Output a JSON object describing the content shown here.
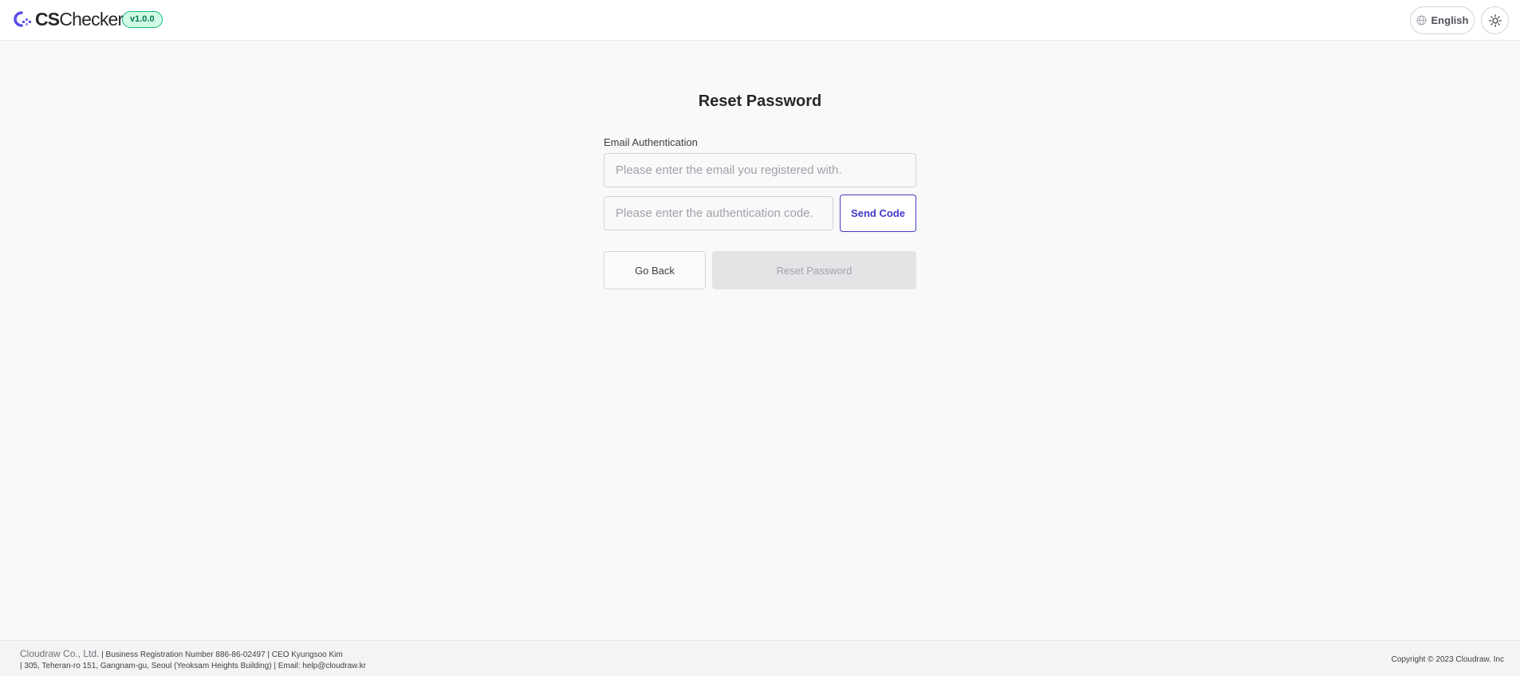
{
  "header": {
    "logo_bold": "CS",
    "logo_light": "Checker",
    "version": "v1.0.0",
    "language": "English",
    "logo_color": "#5b4de6"
  },
  "form": {
    "title": "Reset Password",
    "email_label": "Email Authentication",
    "email_placeholder": "Please enter the email you registered with.",
    "code_placeholder": "Please enter the authentication code.",
    "send_code": "Send Code",
    "go_back": "Go Back",
    "reset_password": "Reset Password"
  },
  "footer": {
    "company": "Cloudraw Co., Ltd.",
    "line1": " | Business Registration Number 886-86-02497 | CEO Kyungsoo Kim",
    "line2": "| 305, Teheran-ro 151, Gangnam-gu, Seoul (Yeoksam Heights Building) | Email: help@cloudraw.kr",
    "copyright": "Copyright © 2023 Cloudraw. Inc"
  },
  "colors": {
    "accent": "#4338ca",
    "badge_border": "#10b981",
    "badge_bg": "#d1fae5",
    "disabled_bg": "#e4e4e7"
  },
  "icons": {
    "logo": "cs-checker-logo-icon",
    "language": "globe-icon",
    "theme": "sun-icon"
  }
}
